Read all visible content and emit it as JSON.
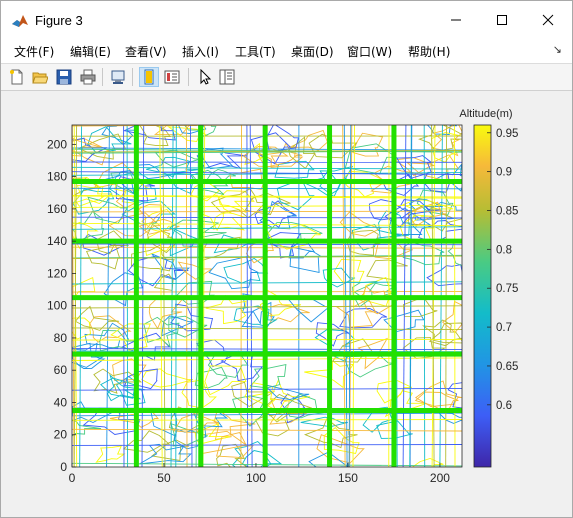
{
  "window": {
    "title": "Figure 3",
    "controls": {
      "minimize": "–",
      "maximize": "☐",
      "close": "✕"
    }
  },
  "menu": [
    "文件(F)",
    "编辑(E)",
    "查看(V)",
    "插入(I)",
    "工具(T)",
    "桌面(D)",
    "窗口(W)",
    "帮助(H)"
  ],
  "toolbar": {
    "buttons": [
      {
        "name": "new-figure-icon"
      },
      {
        "name": "open-file-icon"
      },
      {
        "name": "save-icon"
      },
      {
        "name": "print-icon"
      },
      {
        "name": "link-plot-icon"
      },
      {
        "name": "hide-plot-tools-icon",
        "active": true
      },
      {
        "name": "insert-colorbar-icon"
      },
      {
        "name": "edit-plot-icon"
      },
      {
        "name": "show-plot-tools-icon"
      }
    ]
  },
  "colors": {
    "grid_lines": "#22e000",
    "colorbar_low": "#3e26a8",
    "colorbar_high": "#f9fb0e"
  },
  "chart_data": {
    "type": "contour",
    "title": "",
    "xlabel": "",
    "ylabel": "",
    "xlim": [
      0,
      212
    ],
    "ylim": [
      0,
      212
    ],
    "xticks": [
      0,
      50,
      100,
      150,
      200
    ],
    "yticks": [
      0,
      20,
      40,
      60,
      80,
      100,
      120,
      140,
      160,
      180,
      200
    ],
    "overlay_grid_lines": {
      "x": [
        35,
        70,
        105,
        140,
        175
      ],
      "y": [
        35,
        70,
        105,
        140,
        177
      ]
    },
    "colorbar": {
      "label": "Altitude(m)",
      "limits": [
        0.52,
        0.96
      ],
      "ticks": [
        0.6,
        0.65,
        0.7,
        0.75,
        0.8,
        0.85,
        0.9,
        0.95
      ],
      "tick_labels": [
        "0.6",
        "0.65",
        "0.7",
        "0.75",
        "0.8",
        "0.85",
        "0.9",
        "0.95"
      ]
    }
  }
}
